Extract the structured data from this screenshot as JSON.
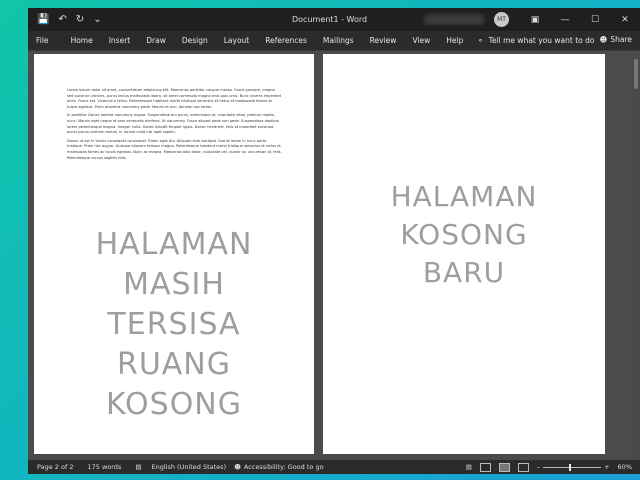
{
  "titlebar": {
    "document_title": "Document1  -  Word",
    "avatar_initials": "MT"
  },
  "ribbon": {
    "tabs": [
      "File",
      "Home",
      "Insert",
      "Draw",
      "Design",
      "Layout",
      "References",
      "Mailings",
      "Review",
      "View",
      "Help"
    ],
    "tell_me": "Tell me what you want to do",
    "share": "Share"
  },
  "document": {
    "page1_paragraphs": [
      "Lorem ipsum dolor sit amet, consectetuer adipiscing elit. Maecenas porttitor congue massa. Fusce posuere, magna sed pulvinar ultricies, purus lectus malesuada libero, sit amet commodo magna eros quis urna. Nunc viverra imperdiet enim. Fusce est. Vivamus a tellus. Pellentesque habitant morbi tristique senectus et netus et malesuada fames ac turpis egestas. Proin pharetra nonummy pede. Mauris et orci. Aenean nec lorem.",
      "In porttitor. Donec laoreet nonummy augue. Suspendisse dui purus, scelerisque at, vulputate vitae, pretium mattis, nunc. Mauris eget neque at sem venenatis eleifend. Ut nonummy. Fusce aliquet pede non pede. Suspendisse dapibus lorem pellentesque magna. Integer nulla. Donec blandit feugiat ligula. Donec hendrerit, felis et imperdiet euismod, purus ipsum pretium metus, in lacinia nulla nisl eget sapien.",
      "Donec ut est in lectus consequat consequat. Etiam eget dui. Aliquam erat volutpat. Sed at lorem in nunc porta tristique. Proin nec augue. Quisque aliquam tempor magna. Pellentesque habitant morbi tristique senectus et netus et malesuada fames ac turpis egestas. Nunc ac magna. Maecenas odio dolor, vulputate vel, auctor ac, accumsan id, felis. Pellentesque cursus sagittis felis."
    ],
    "page1_overlay_lines": [
      "HALAMAN",
      "MASIH",
      "TERSISA",
      "RUANG",
      "KOSONG"
    ],
    "page2_overlay_lines": [
      "HALAMAN",
      "KOSONG",
      "BARU"
    ]
  },
  "statusbar": {
    "page": "Page 2 of 2",
    "words": "175 words",
    "language": "English (United States)",
    "accessibility": "Accessibility: Good to go",
    "zoom": "60%"
  }
}
